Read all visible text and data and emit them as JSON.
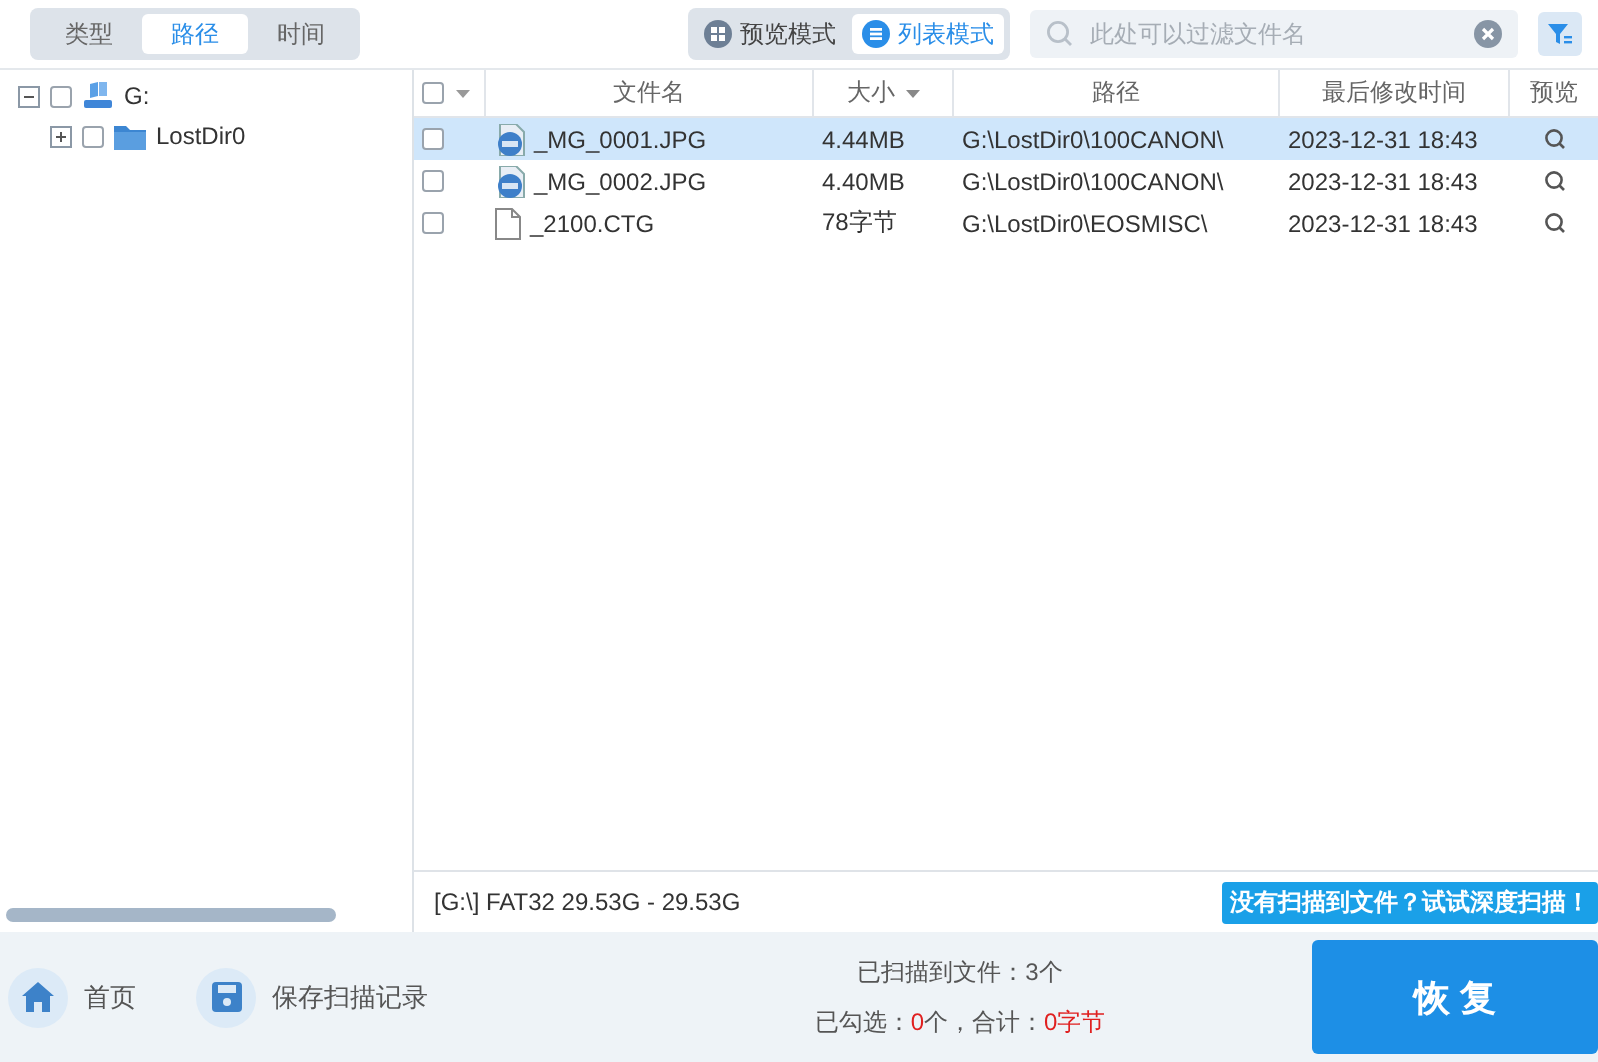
{
  "category_tabs": [
    {
      "label": "类型",
      "selected": false
    },
    {
      "label": "路径",
      "selected": true
    },
    {
      "label": "时间",
      "selected": false
    }
  ],
  "view_modes": [
    {
      "label": "预览模式",
      "kind": "grid",
      "selected": false
    },
    {
      "label": "列表模式",
      "kind": "list",
      "selected": true
    }
  ],
  "filter": {
    "placeholder": "此处可以过滤文件名"
  },
  "tree": [
    {
      "label": "G:",
      "kind": "drive",
      "expanded": true,
      "checked": false,
      "children": [
        {
          "label": "LostDir0",
          "kind": "folder",
          "expanded": false,
          "checked": false
        }
      ]
    }
  ],
  "table": {
    "all_checked": false,
    "columns": [
      {
        "label": "文件名",
        "sorted": false
      },
      {
        "label": "大小",
        "sorted": true
      },
      {
        "label": "路径",
        "sorted": false
      },
      {
        "label": "最后修改时间",
        "sorted": false
      },
      {
        "label": "预览",
        "sorted": false
      }
    ],
    "rows": [
      {
        "kind": "image",
        "checked": false,
        "selected": true,
        "name": "_MG_0001.JPG",
        "size": "4.44MB",
        "path": "G:\\LostDir0\\100CANON\\",
        "modified": "2023-12-31  18:43"
      },
      {
        "kind": "image",
        "checked": false,
        "selected": false,
        "name": "_MG_0002.JPG",
        "size": "4.40MB",
        "path": "G:\\LostDir0\\100CANON\\",
        "modified": "2023-12-31  18:43"
      },
      {
        "kind": "file",
        "checked": false,
        "selected": false,
        "name": "_2100.CTG",
        "size": "78字节",
        "path": "G:\\LostDir0\\EOSMISC\\",
        "modified": "2023-12-31  18:43"
      }
    ]
  },
  "status_bar": {
    "disk_info": "[G:\\] FAT32 29.53G - 29.53G",
    "deep_scan_link": "没有扫描到文件？试试深度扫描！"
  },
  "bottom_bar": {
    "home": "首页",
    "save_record": "保存扫描记录",
    "scanned": "已扫描到文件：3个",
    "selected_label": "已勾选：",
    "selected_count": "0",
    "total_label": "个，合计：",
    "total_size": "0字节",
    "recover_button": "恢 复"
  }
}
